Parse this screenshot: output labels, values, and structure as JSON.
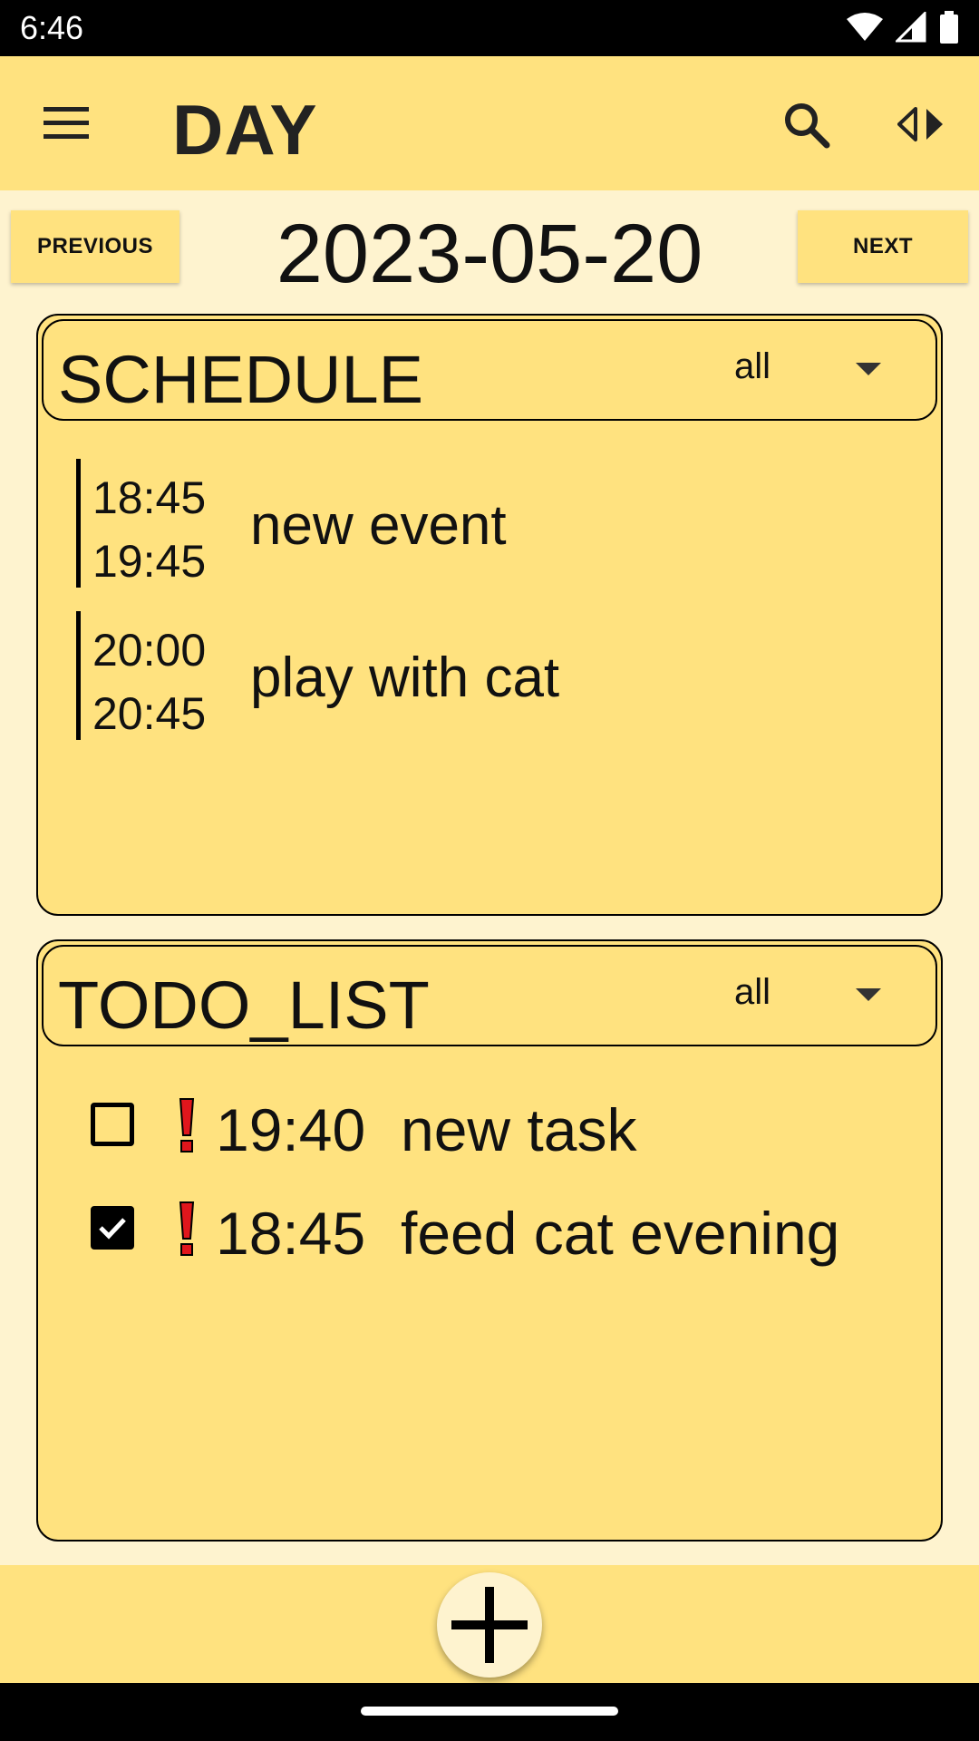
{
  "status_bar": {
    "time": "6:46"
  },
  "app_bar": {
    "title": "DAY"
  },
  "date_nav": {
    "previous_label": "PREVIOUS",
    "next_label": "NEXT",
    "date": "2023-05-20"
  },
  "schedule": {
    "title": "SCHEDULE",
    "filter": "all",
    "events": [
      {
        "start": "18:45",
        "end": "19:45",
        "name": "new event"
      },
      {
        "start": "20:00",
        "end": "20:45",
        "name": "play with cat"
      }
    ]
  },
  "todo": {
    "title": "TODO_LIST",
    "filter": "all",
    "tasks": [
      {
        "checked": false,
        "priority": "high",
        "time": "19:40",
        "name": "new task"
      },
      {
        "checked": true,
        "priority": "high",
        "time": "18:45",
        "name": "feed cat evening"
      }
    ]
  },
  "colors": {
    "primary": "#ffe27f",
    "background": "#fef3cf",
    "priority": "#e0161c"
  },
  "icons": {
    "menu": "menu-icon",
    "search": "search-icon",
    "swap": "swap-icon",
    "add": "add-icon"
  }
}
